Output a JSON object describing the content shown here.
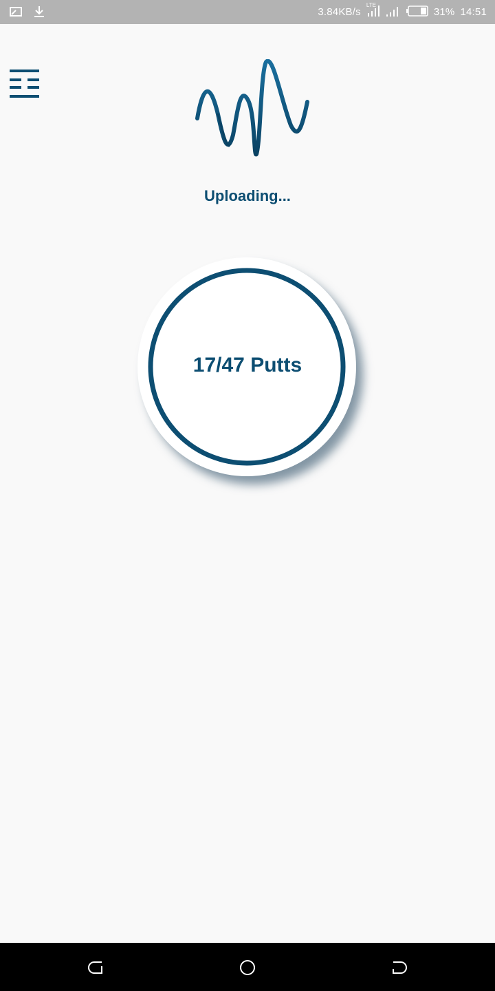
{
  "status_bar": {
    "network_speed": "3.84KB/s",
    "network_type": "LTE",
    "battery": "31%",
    "time": "14:51",
    "left_icons": [
      "screen-cast-icon",
      "download-icon"
    ]
  },
  "header": {
    "menu_icon": "menu-icon",
    "logo_icon": "waveform-logo-icon"
  },
  "upload": {
    "status_text": "Uploading...",
    "progress_label": "17/47 Putts",
    "completed": 17,
    "total": 47
  },
  "nav_bar": {
    "back": "back-icon",
    "home": "home-icon",
    "recents": "recents-icon"
  },
  "colors": {
    "primary": "#0d4e72",
    "status_bar_bg": "#b3b3b3",
    "background": "#f9f9f9",
    "nav_bar_bg": "#000000"
  }
}
